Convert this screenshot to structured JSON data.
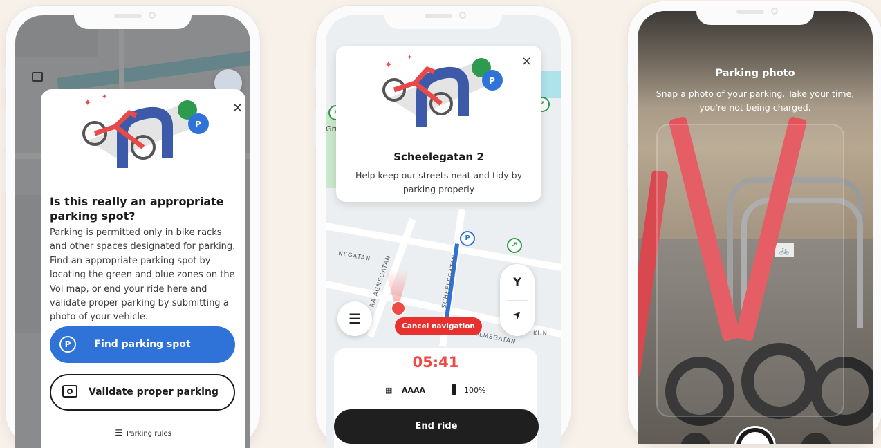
{
  "phone1": {
    "card": {
      "heading": "Is this really an appropriate parking spot?",
      "body": "Parking is permitted only in bike racks and other spaces designated for parking. Find an appropriate parking spot by locating the green and blue zones on the Voi map, or end your ride here and validate proper parking by submitting a photo of your vehicle.",
      "close_icon": "×",
      "find_button": "Find parking spot",
      "find_icon": "P",
      "validate_button": "Validate proper parking",
      "rules_link": "Parking rules",
      "rules_icon": "☰"
    }
  },
  "phone2": {
    "popup": {
      "title": "Scheelegatan 2",
      "subtitle": "Help keep our streets neat and tidy by parking properly",
      "close_icon": "×"
    },
    "cancel_navigation": "Cancel navigation",
    "menu_icon": "☰",
    "filter_icon": "Y",
    "locate_icon": "➤",
    "ride": {
      "timer": "05:41",
      "vehicle_code": "AAAA",
      "battery": "100%",
      "end_ride": "End ride"
    },
    "map_labels": [
      "SCHEELEGATAN",
      "NEGATAN",
      "RA AGNEGATAN",
      "OLMSGATAN",
      "KUN",
      "Gru"
    ]
  },
  "phone3": {
    "title": "Parking photo",
    "subtitle": "Snap a photo of your parking. Take your time, you're not being charged."
  },
  "colors": {
    "background": "#f8f1ea",
    "voi_blue": "#2f73d9",
    "voi_red": "#ef4a45",
    "park_green": "#2e9a4d"
  }
}
